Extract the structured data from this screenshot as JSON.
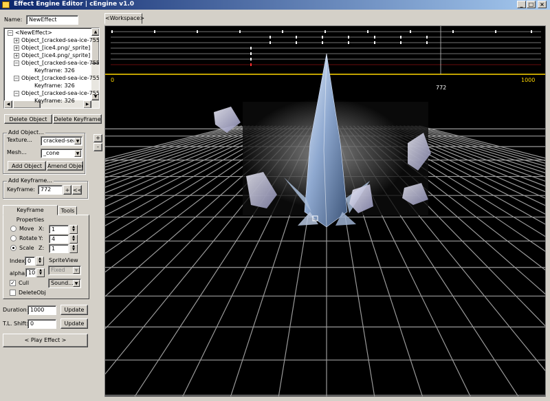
{
  "window": {
    "title": "Effect Engine Editor | cEngine v1.0"
  },
  "name_field": {
    "label": "Name:",
    "value": "NewEffect"
  },
  "tree": {
    "root": "<NewEffect>",
    "rows": [
      {
        "kind": "object",
        "expander": "+",
        "label": "Object_[cracked-sea-ice-755"
      },
      {
        "kind": "object",
        "expander": "+",
        "label": "Object_[ice4.png/_sprite]"
      },
      {
        "kind": "object",
        "expander": "+",
        "label": "Object_[ice4.png/_sprite]"
      },
      {
        "kind": "object",
        "expander": "−",
        "label": "Object_[cracked-sea-ice-755"
      },
      {
        "kind": "keyframe",
        "label": "Keyframe: 326"
      },
      {
        "kind": "object",
        "expander": "−",
        "label": "Object_[cracked-sea-ice-755"
      },
      {
        "kind": "keyframe",
        "label": "Keyframe: 326"
      },
      {
        "kind": "object",
        "expander": "−",
        "label": "Object_[cracked-sea-ice-755"
      },
      {
        "kind": "keyframe",
        "label": "Keyframe: 326"
      }
    ]
  },
  "buttons": {
    "delete_object": "Delete Object",
    "delete_keyframe": "Delete KeyFrame",
    "add_object": "Add Object",
    "amend_object": "Amend Object",
    "plus": "+",
    "minus": "-",
    "kf_plus": "+",
    "kf_rewind": "<<",
    "update_duration": "Update",
    "update_shift": "Update",
    "play_effect": "< Play Effect >"
  },
  "add_object": {
    "group_label": "Add Object...",
    "texture_label": "Texture...",
    "texture_value": "cracked-sea-i",
    "mesh_label": "Mesh...",
    "mesh_value": "_cone"
  },
  "add_keyframe": {
    "group_label": "Add Keyframe...",
    "keyframe_label": "Keyframe:",
    "keyframe_value": "772"
  },
  "props_tabs": {
    "active": "KeyFrame Properties",
    "other": "Tools"
  },
  "transform": {
    "modes": [
      {
        "label": "Move",
        "selected": false
      },
      {
        "label": "Rotate",
        "selected": false
      },
      {
        "label": "Scale",
        "selected": true
      }
    ],
    "axes": [
      {
        "label": "X:",
        "value": "1"
      },
      {
        "label": "Y:",
        "value": "4"
      },
      {
        "label": "Z:",
        "value": "1"
      }
    ]
  },
  "index": {
    "label": "Index:",
    "value": "0"
  },
  "alpha": {
    "label": "alpha:",
    "value": "10"
  },
  "sprite_view": {
    "label": "SpriteView",
    "value": "Fixed"
  },
  "cull": {
    "label": "Cull",
    "checked": true
  },
  "delete_obj": {
    "label": "DeleteObj",
    "checked": false
  },
  "sound": {
    "value": "Sound..."
  },
  "duration": {
    "label": "Duration:",
    "value": "1000"
  },
  "tl_shift": {
    "label": "T.L. Shift:",
    "value": "0"
  },
  "workspace": {
    "tab": "<Workspace>",
    "timeline": {
      "start": "0",
      "end": "1000",
      "cursor": 772
    }
  },
  "window_controls": {
    "minimize": "_",
    "maximize": "□",
    "close": "×"
  },
  "colors": {
    "title_start": "#0a246a",
    "title_end": "#a6caf0",
    "timeline_line": "#ffd700",
    "grid": "#b0b0b0",
    "keyframe_marker": "#ff3030"
  }
}
